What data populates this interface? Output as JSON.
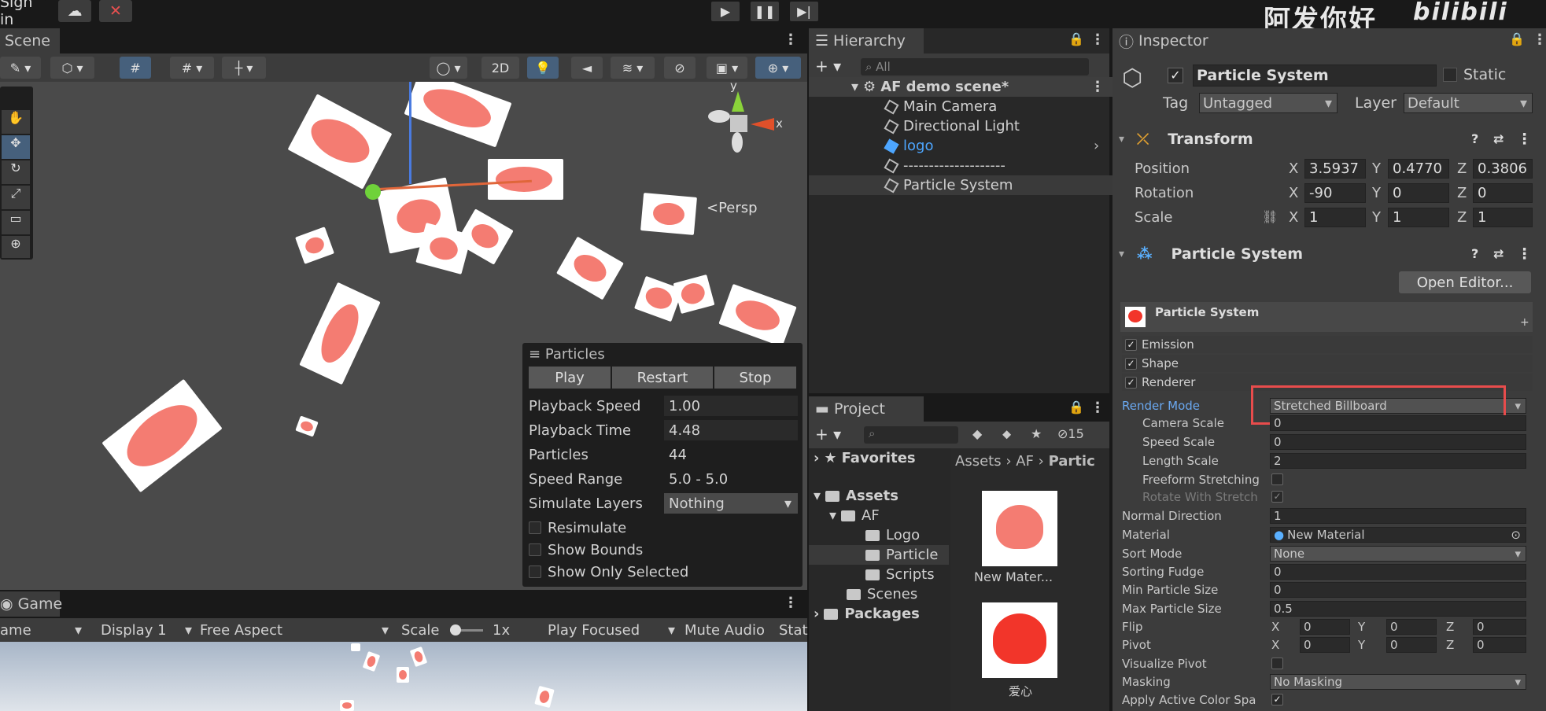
{
  "topbar": {
    "sign_in": "Sign in",
    "watermark": "阿发你好"
  },
  "scene": {
    "tab": "Scene",
    "persp": "Persp",
    "mode_2d": "2D",
    "gizmo_y": "y",
    "gizmo_x": "x"
  },
  "particles_overlay": {
    "title": "Particles",
    "play": "Play",
    "restart": "Restart",
    "stop": "Stop",
    "rows": [
      {
        "label": "Playback Speed",
        "value": "1.00"
      },
      {
        "label": "Playback Time",
        "value": "4.48"
      },
      {
        "label": "Particles",
        "value": "44"
      },
      {
        "label": "Speed Range",
        "value": "5.0 - 5.0"
      },
      {
        "label": "Simulate Layers",
        "value": "Nothing"
      }
    ],
    "checks": [
      "Resimulate",
      "Show Bounds",
      "Show Only Selected"
    ]
  },
  "game": {
    "tab": "Game",
    "mode": "ame",
    "display": "Display 1",
    "aspect": "Free Aspect",
    "scale_label": "Scale",
    "scale_value": "1x",
    "play_focused": "Play Focused",
    "mute": "Mute Audio",
    "stats": "Stat"
  },
  "hierarchy": {
    "tab": "Hierarchy",
    "search_placeholder": "All",
    "scene_name": "AF demo scene*",
    "items": [
      "Main Camera",
      "Directional Light",
      "logo",
      "--------------------",
      "Particle System"
    ]
  },
  "project": {
    "tab": "Project",
    "count": "15",
    "favorites": "Favorites",
    "assets": "Assets",
    "af": "AF",
    "logo": "Logo",
    "particle": "Particle",
    "scripts": "Scripts",
    "scenes": "Scenes",
    "packages": "Packages",
    "breadcrumb": [
      "Assets",
      "AF",
      "Partic"
    ],
    "files": [
      "New Mater...",
      "爱心"
    ]
  },
  "inspector": {
    "tab": "Inspector",
    "object_name": "Particle System",
    "static": "Static",
    "tag_label": "Tag",
    "tag_value": "Untagged",
    "layer_label": "Layer",
    "layer_value": "Default",
    "transform": {
      "title": "Transform",
      "rows": [
        {
          "label": "Position",
          "x": "3.5937",
          "y": "0.4770",
          "z": "0.3806"
        },
        {
          "label": "Rotation",
          "x": "-90",
          "y": "0",
          "z": "0"
        },
        {
          "label": "Scale",
          "x": "1",
          "y": "1",
          "z": "1"
        }
      ]
    },
    "ps_header": "Particle System",
    "open_editor": "Open Editor...",
    "ps_module": "Particle System",
    "modules": [
      "Emission",
      "Shape",
      "Renderer"
    ],
    "props": [
      {
        "label": "Render Mode",
        "value": "Stretched Billboard"
      },
      {
        "label": "Camera Scale",
        "value": "0"
      },
      {
        "label": "Speed Scale",
        "value": "0"
      },
      {
        "label": "Length Scale",
        "value": "2"
      },
      {
        "label": "Freeform Stretching",
        "value": ""
      },
      {
        "label": "Rotate With Stretch",
        "value": "✓"
      },
      {
        "label": "Normal Direction",
        "value": "1"
      },
      {
        "label": "Material",
        "value": "New Material"
      },
      {
        "label": "Sort Mode",
        "value": "None"
      },
      {
        "label": "Sorting Fudge",
        "value": "0"
      },
      {
        "label": "Min Particle Size",
        "value": "0"
      },
      {
        "label": "Max Particle Size",
        "value": "0.5"
      },
      {
        "label": "Flip",
        "value": ""
      },
      {
        "label": "Pivot",
        "value": ""
      },
      {
        "label": "Visualize Pivot",
        "value": ""
      },
      {
        "label": "Masking",
        "value": "No Masking"
      },
      {
        "label": "Apply Active Color Spa",
        "value": "✓"
      }
    ],
    "xyz": {
      "x": "X",
      "y": "Y",
      "z": "Z",
      "zero": "0"
    }
  }
}
